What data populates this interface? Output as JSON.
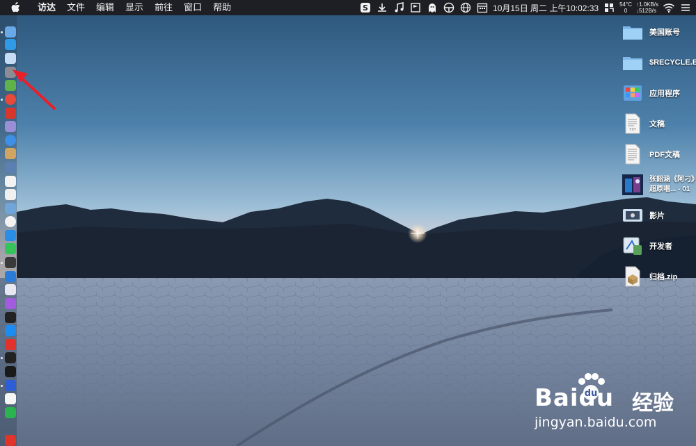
{
  "menubar": {
    "apple_icon": "apple-logo-icon",
    "items": [
      "访达",
      "文件",
      "编辑",
      "显示",
      "前往",
      "窗口",
      "帮助"
    ],
    "status": {
      "datetime": "10月15日 周二 上午10:02:33",
      "temp": "54°C",
      "fan": "0",
      "net_up": "↑1.0KB/s",
      "net_down": "↓512B/s",
      "icons": [
        "sogou-input-icon",
        "download-icon",
        "music-note-icon",
        "flag-icon",
        "ghost-icon",
        "steering-icon",
        "globe-icon",
        "calendar-icon",
        "display-icon",
        "grid-icon",
        "wifi-icon"
      ]
    }
  },
  "desktop_icons": [
    {
      "label": "美国账号",
      "icon": "folder-icon"
    },
    {
      "label": "$RECYCLE.BIN",
      "icon": "folder-icon"
    },
    {
      "label": "应用程序",
      "icon": "applications-folder-icon"
    },
    {
      "label": "文稿",
      "icon": "text-document-icon"
    },
    {
      "label": "PDF文稿",
      "icon": "pdf-document-icon"
    },
    {
      "label_line1": "张韶涵《阿刁》",
      "label_line2": "超原唱... - 01",
      "icon": "video-thumbnail-icon"
    },
    {
      "label": "影片",
      "icon": "movies-folder-icon"
    },
    {
      "label": "开发者",
      "icon": "developer-folder-icon"
    },
    {
      "label": "归档.zip",
      "icon": "zip-archive-icon"
    }
  ],
  "dock_icons": [
    "finder-icon",
    "safari-like-icon",
    "launchpad-icon",
    "system-preferences-icon",
    "android-studio-icon",
    "chrome-icon",
    "wps-icon",
    "calculator-icon",
    "safari-icon",
    "notes-icon",
    "preview-icon",
    "reminders-icon",
    "calendar-icon",
    "maps-icon",
    "photos-icon",
    "messages-icon",
    "wechat-icon",
    "screenshot-icon",
    "keynote-icon",
    "itunes-icon",
    "podcasts-icon",
    "apple-tv-icon",
    "app-store-icon",
    "vivaldi-icon",
    "terminal-icon",
    "activity-monitor-icon",
    "vpn-icon",
    "yandex-icon",
    "facetime-icon",
    "weibo-icon"
  ],
  "watermark": {
    "brand": "Baidu",
    "sub": "经验",
    "url": "jingyan.baidu.com"
  },
  "colors": {
    "menubar": "#1d1f24",
    "annotation_arrow": "#e8202a",
    "sky_top": "#2f5a7e",
    "sky_horizon": "#f0dcd8",
    "playa": "#8d9db4"
  }
}
